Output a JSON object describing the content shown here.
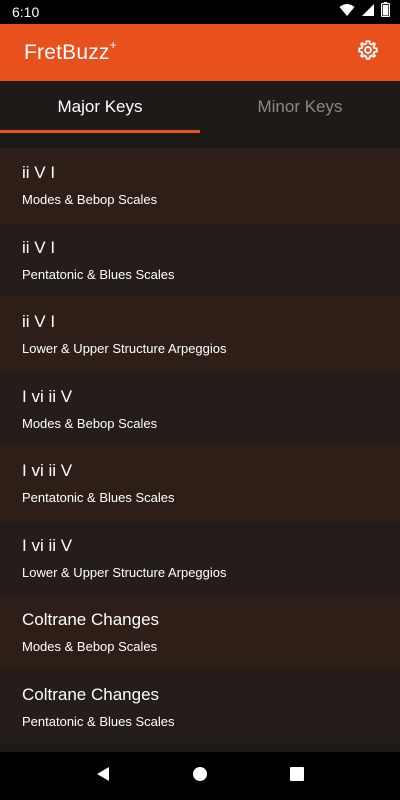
{
  "status_bar": {
    "time": "6:10",
    "icons": [
      "wifi-icon",
      "signal-icon",
      "battery-icon"
    ]
  },
  "app_bar": {
    "title": "FretBuzz",
    "title_superscript": "+",
    "settings_icon": "gear-icon",
    "color": "#e8501e"
  },
  "tabs": [
    {
      "label": "Major Keys",
      "active": true
    },
    {
      "label": "Minor Keys",
      "active": false
    }
  ],
  "items": [
    {
      "title": "ii V I",
      "subtitle": "Modes & Bebop Scales"
    },
    {
      "title": "ii V I",
      "subtitle": "Pentatonic & Blues Scales"
    },
    {
      "title": "ii V I",
      "subtitle": "Lower & Upper Structure Arpeggios"
    },
    {
      "title": "I vi ii V",
      "subtitle": "Modes & Bebop Scales"
    },
    {
      "title": "I vi ii V",
      "subtitle": "Pentatonic & Blues Scales"
    },
    {
      "title": "I vi ii V",
      "subtitle": "Lower & Upper Structure Arpeggios"
    },
    {
      "title": "Coltrane Changes",
      "subtitle": "Modes & Bebop Scales"
    },
    {
      "title": "Coltrane Changes",
      "subtitle": "Pentatonic & Blues Scales"
    }
  ],
  "nav_bar": {
    "icons": [
      "back-icon",
      "home-icon",
      "recents-icon"
    ]
  }
}
